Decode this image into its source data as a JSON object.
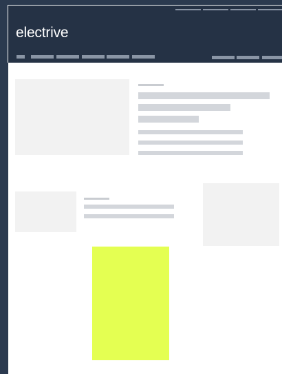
{
  "header": {
    "logo": "electrive",
    "background": "#253245",
    "logo_color": "#ffffff"
  },
  "content": {
    "background": "#ffffff",
    "placeholder_color": "#f2f2f2",
    "line_color": "#d3d6db",
    "ad_color": "#e4ff52"
  }
}
